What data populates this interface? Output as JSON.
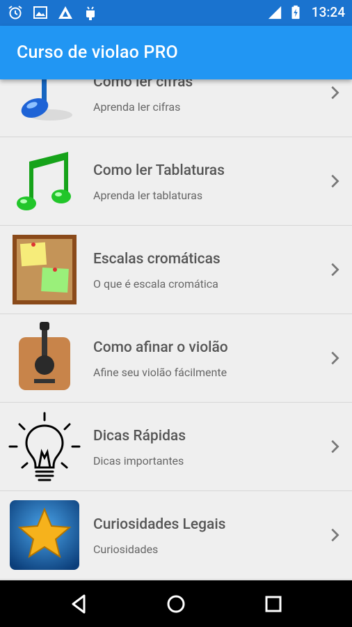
{
  "status_bar": {
    "time": "13:24",
    "left_icons": [
      "alarm-icon",
      "image-icon",
      "app-icon",
      "android-icon"
    ],
    "right_icons": [
      "signal-icon",
      "battery-charging-icon"
    ]
  },
  "app_bar": {
    "title": "Curso de violao PRO",
    "color": "#2196f3"
  },
  "list": {
    "items": [
      {
        "title": "Como ler cifras",
        "subtitle": "Aprenda ler cifras",
        "icon": "blue-music-note-icon"
      },
      {
        "title": "Como ler Tablaturas",
        "subtitle": "Aprenda ler tablaturas",
        "icon": "green-music-note-icon"
      },
      {
        "title": "Escalas cromáticas",
        "subtitle": "O que é escala cromática",
        "icon": "corkboard-notes-icon"
      },
      {
        "title": "Como afinar o violão",
        "subtitle": "Afine seu violão fácilmente",
        "icon": "guitar-icon"
      },
      {
        "title": "Dicas Rápidas",
        "subtitle": "Dicas importantes",
        "icon": "lightbulb-icon"
      },
      {
        "title": "Curiosidades Legais",
        "subtitle": "Curiosidades",
        "icon": "gold-star-icon"
      }
    ]
  },
  "nav_bar": {
    "buttons": [
      "back-icon",
      "home-icon",
      "recents-icon"
    ]
  }
}
